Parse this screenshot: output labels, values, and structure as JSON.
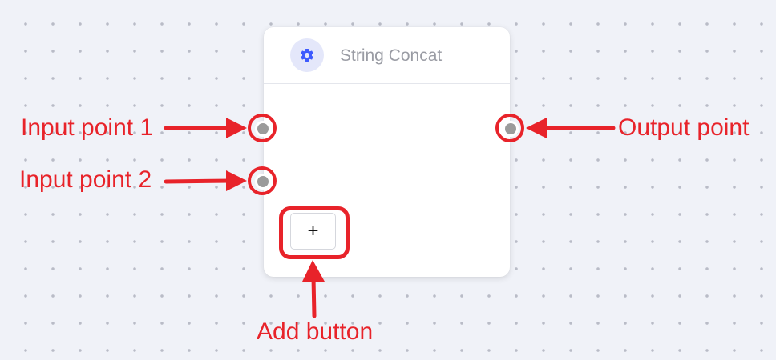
{
  "node": {
    "title": "String Concat",
    "icon": "gear-icon",
    "icon_color": "#3d5afe",
    "icon_bg": "#e4e7fa",
    "add_button_label": "+"
  },
  "annotations": {
    "input_point_1": "Input point 1",
    "input_point_2": "Input point 2",
    "output_point": "Output point",
    "add_button": "Add button",
    "color": "#e8232a"
  }
}
